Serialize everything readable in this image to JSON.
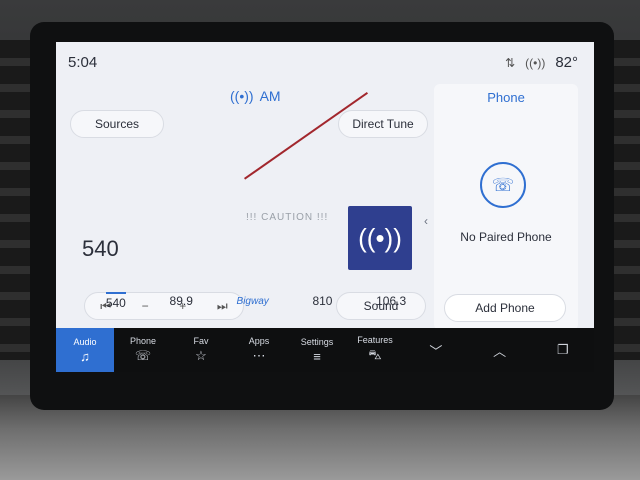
{
  "status": {
    "time": "5:04",
    "temperature": "82°",
    "icons": [
      "signal-icon",
      "wifi-icon"
    ]
  },
  "audio": {
    "source_label": "AM",
    "sources_button": "Sources",
    "direct_tune_button": "Direct Tune",
    "frequency": "540",
    "sound_button": "Sound",
    "sticker_text": "!!! CAUTION !!!",
    "presets": [
      {
        "label": "540"
      },
      {
        "label": "89.9"
      },
      {
        "label": "Bigway"
      },
      {
        "label": "810"
      },
      {
        "label": "106.3"
      }
    ],
    "controls": {
      "prev": "⏮",
      "minus": "−",
      "plus": "+",
      "next": "⏭"
    }
  },
  "phone": {
    "title": "Phone",
    "status": "No Paired Phone",
    "add_button": "Add Phone"
  },
  "nav": [
    {
      "label": "Audio",
      "icon": "♫"
    },
    {
      "label": "Phone",
      "icon": "☏"
    },
    {
      "label": "Fav",
      "icon": "☆"
    },
    {
      "label": "Apps",
      "icon": "⋯"
    },
    {
      "label": "Settings",
      "icon": "≡"
    },
    {
      "label": "Features",
      "icon": "⛍"
    }
  ],
  "nav_extra": {
    "down": "﹀",
    "up": "︿",
    "copy": "❐"
  },
  "colors": {
    "accent": "#2f6fd1",
    "nav_bg": "#0e0f10",
    "screen_bg": "#eef0f5"
  }
}
